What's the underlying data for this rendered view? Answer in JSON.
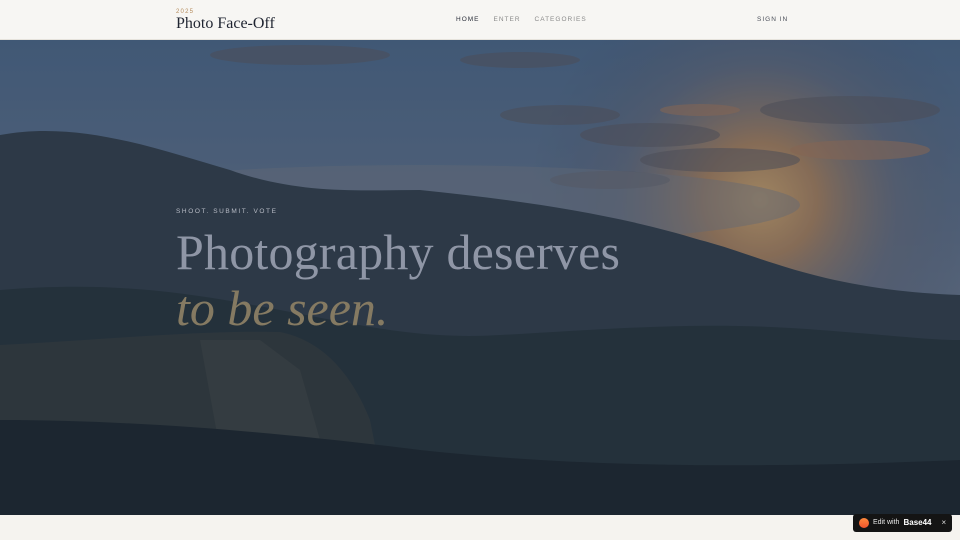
{
  "header": {
    "brand_year": "2025",
    "brand_name": "Photo Face-Off",
    "nav": [
      {
        "label": "HOME",
        "active": true
      },
      {
        "label": "ENTER",
        "active": false
      },
      {
        "label": "CATEGORIES",
        "active": false
      }
    ],
    "signin_label": "SIGN IN"
  },
  "hero": {
    "eyebrow": "SHOOT. SUBMIT. VOTE",
    "headline": "Photography deserves",
    "headline_accent": "to be seen.",
    "image_subject": "misty mountain landscape at sunset"
  },
  "badge": {
    "prefix": "Edit with",
    "brand": "Base44",
    "close": "×"
  },
  "colors": {
    "accent_gold": "#b58c5c",
    "overlay_navy": "#182038"
  }
}
